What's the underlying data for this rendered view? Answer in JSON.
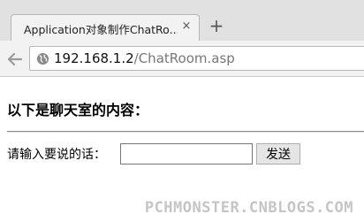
{
  "browser": {
    "tab_title": "Application对象制作ChatRo...",
    "tab_close": "×",
    "new_tab": "+",
    "url_host": "192.168.1.2",
    "url_path": "/ChatRoom.asp"
  },
  "page": {
    "heading": "以下是聊天室的内容：",
    "prompt_label": "请输入要说的话：",
    "message_input_value": "",
    "send_label": "发送"
  },
  "watermark": "PCHMONSTER.CNBLOGS.COM"
}
